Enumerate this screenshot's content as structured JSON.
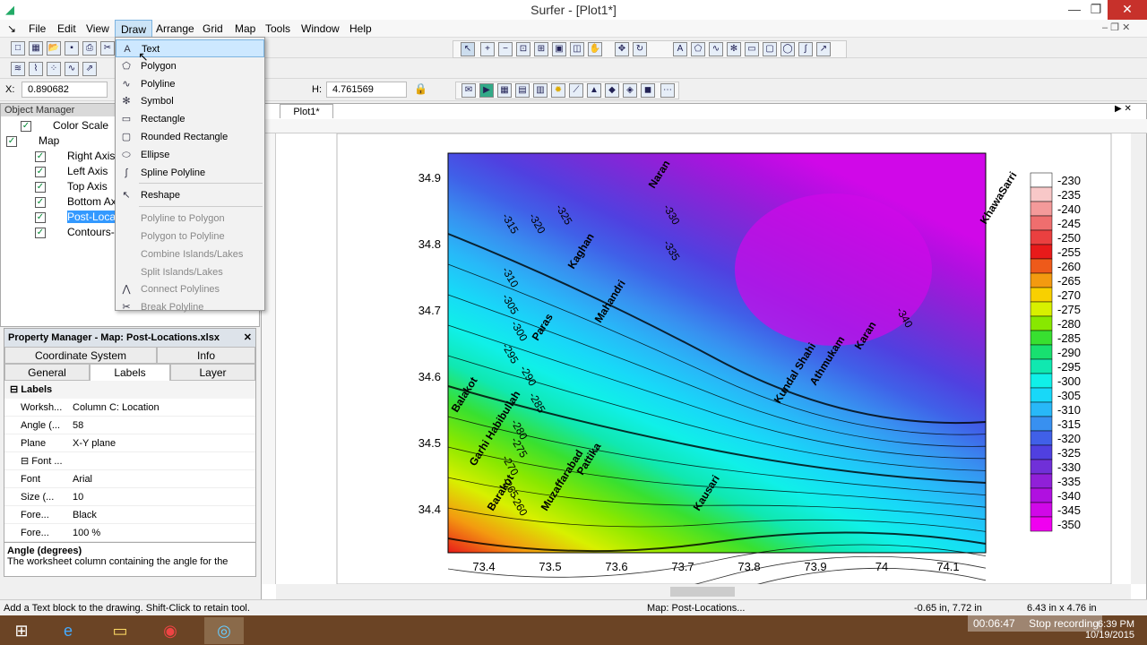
{
  "app": {
    "title": "Surfer - [Plot1*]",
    "min": "—",
    "restore": "❐",
    "close": "✕"
  },
  "menus": [
    "File",
    "Edit",
    "View",
    "Draw",
    "Arrange",
    "Grid",
    "Map",
    "Tools",
    "Window",
    "Help"
  ],
  "coords": {
    "x_label": "X:",
    "x_value": "0.890682",
    "h_label": "H:",
    "h_value": "4.761569"
  },
  "draw_menu": {
    "items": [
      {
        "label": "Text",
        "icon": "A",
        "enabled": true,
        "highlight": true
      },
      {
        "label": "Polygon",
        "icon": "⬠",
        "enabled": true
      },
      {
        "label": "Polyline",
        "icon": "∿",
        "enabled": true
      },
      {
        "label": "Symbol",
        "icon": "✻",
        "enabled": true
      },
      {
        "label": "Rectangle",
        "icon": "▭",
        "enabled": true
      },
      {
        "label": "Rounded Rectangle",
        "icon": "▢",
        "enabled": true
      },
      {
        "label": "Ellipse",
        "icon": "⬭",
        "enabled": true
      },
      {
        "label": "Spline Polyline",
        "icon": "∫",
        "enabled": true
      },
      {
        "label": "Reshape",
        "icon": "↖",
        "enabled": true
      },
      {
        "label": "Polyline to Polygon",
        "icon": "",
        "enabled": false
      },
      {
        "label": "Polygon to Polyline",
        "icon": "",
        "enabled": false
      },
      {
        "label": "Combine Islands/Lakes",
        "icon": "",
        "enabled": false
      },
      {
        "label": "Split Islands/Lakes",
        "icon": "",
        "enabled": false
      },
      {
        "label": "Connect Polylines",
        "icon": "⋀",
        "enabled": false
      },
      {
        "label": "Break Polyline",
        "icon": "✂",
        "enabled": false
      }
    ]
  },
  "object_manager": {
    "title": "Object Manager",
    "items": [
      {
        "label": "Color Scale",
        "indent": 1
      },
      {
        "label": "Map",
        "indent": 0
      },
      {
        "label": "Right Axis",
        "indent": 2
      },
      {
        "label": "Left Axis",
        "indent": 2
      },
      {
        "label": "Top Axis",
        "indent": 2
      },
      {
        "label": "Bottom Axis",
        "indent": 2
      },
      {
        "label": "Post-Locations",
        "indent": 2,
        "selected": true
      },
      {
        "label": "Contours-B...",
        "indent": 2
      }
    ]
  },
  "property_manager": {
    "title": "Property Manager - Map: Post-Locations.xlsx",
    "tabs_row1": [
      "Coordinate System",
      "Info"
    ],
    "tabs_row2": [
      "General",
      "Labels",
      "Layer"
    ],
    "section": "Labels",
    "rows": [
      {
        "k": "Worksh...",
        "v": "Column C:  Location"
      },
      {
        "k": "Angle (...",
        "v": "58"
      },
      {
        "k": "Plane",
        "v": "X-Y plane"
      },
      {
        "k": "⊟ Font ...",
        "v": ""
      },
      {
        "k": "Font",
        "v": "Arial"
      },
      {
        "k": "Size (...",
        "v": "10"
      },
      {
        "k": "Fore...",
        "v": "Black"
      },
      {
        "k": "Fore...",
        "v": "100 %"
      }
    ],
    "help_title": "Angle (degrees)",
    "help_text": "The worksheet column containing the angle for the"
  },
  "plot_tab": "Plot1*",
  "status": {
    "left": "Add a Text block to the drawing.  Shift-Click to retain tool.",
    "mid": "Map: Post-Locations...",
    "pos": "-0.65 in, 7.72 in",
    "size": "6.43 in x 4.76 in"
  },
  "taskbar": {
    "time": "6:39 PM",
    "date": "10/19/2015",
    "rec": "00:06:47",
    "stop": "Stop recording"
  },
  "chart_data": {
    "type": "heatmap",
    "x_ticks": [
      "73.4",
      "73.5",
      "73.6",
      "73.7",
      "73.8",
      "73.9",
      "74",
      "74.1"
    ],
    "y_ticks": [
      "34.9",
      "34.8",
      "34.7",
      "34.6",
      "34.5",
      "34.4"
    ],
    "legend": [
      "-230",
      "-235",
      "-240",
      "-245",
      "-250",
      "-255",
      "-260",
      "-265",
      "-270",
      "-275",
      "-280",
      "-285",
      "-290",
      "-295",
      "-300",
      "-305",
      "-310",
      "-315",
      "-320",
      "-325",
      "-330",
      "-335",
      "-340",
      "-345",
      "-350"
    ],
    "legend_colors": [
      "#ffffff",
      "#f8c8c8",
      "#f49a9a",
      "#ef6e6e",
      "#ea4040",
      "#e81a1a",
      "#ee5a1a",
      "#f39a10",
      "#f8d000",
      "#d8f000",
      "#88e800",
      "#38e030",
      "#18e070",
      "#10e8b0",
      "#10f0e8",
      "#18d8f8",
      "#28b8f8",
      "#3890f0",
      "#4060e8",
      "#5040e0",
      "#7030d8",
      "#9020d8",
      "#b010e0",
      "#d008e8",
      "#f000f0"
    ],
    "contour_labels": [
      "-315",
      "-320",
      "-325",
      "-330",
      "-335",
      "-310",
      "-305",
      "-300",
      "-295",
      "-290",
      "-285",
      "-280",
      "-275",
      "-270",
      "-265",
      "-260",
      "-340"
    ],
    "locations": [
      "Naran",
      "Kaghan",
      "Mahandri",
      "Paras",
      "Balakot",
      "Garhi Habibullah",
      "Barakot",
      "Muzaffarabad",
      "Pattika",
      "Kausari",
      "Kundal Shahi",
      "Athmukam",
      "Karan",
      "KhawaSarri"
    ]
  }
}
